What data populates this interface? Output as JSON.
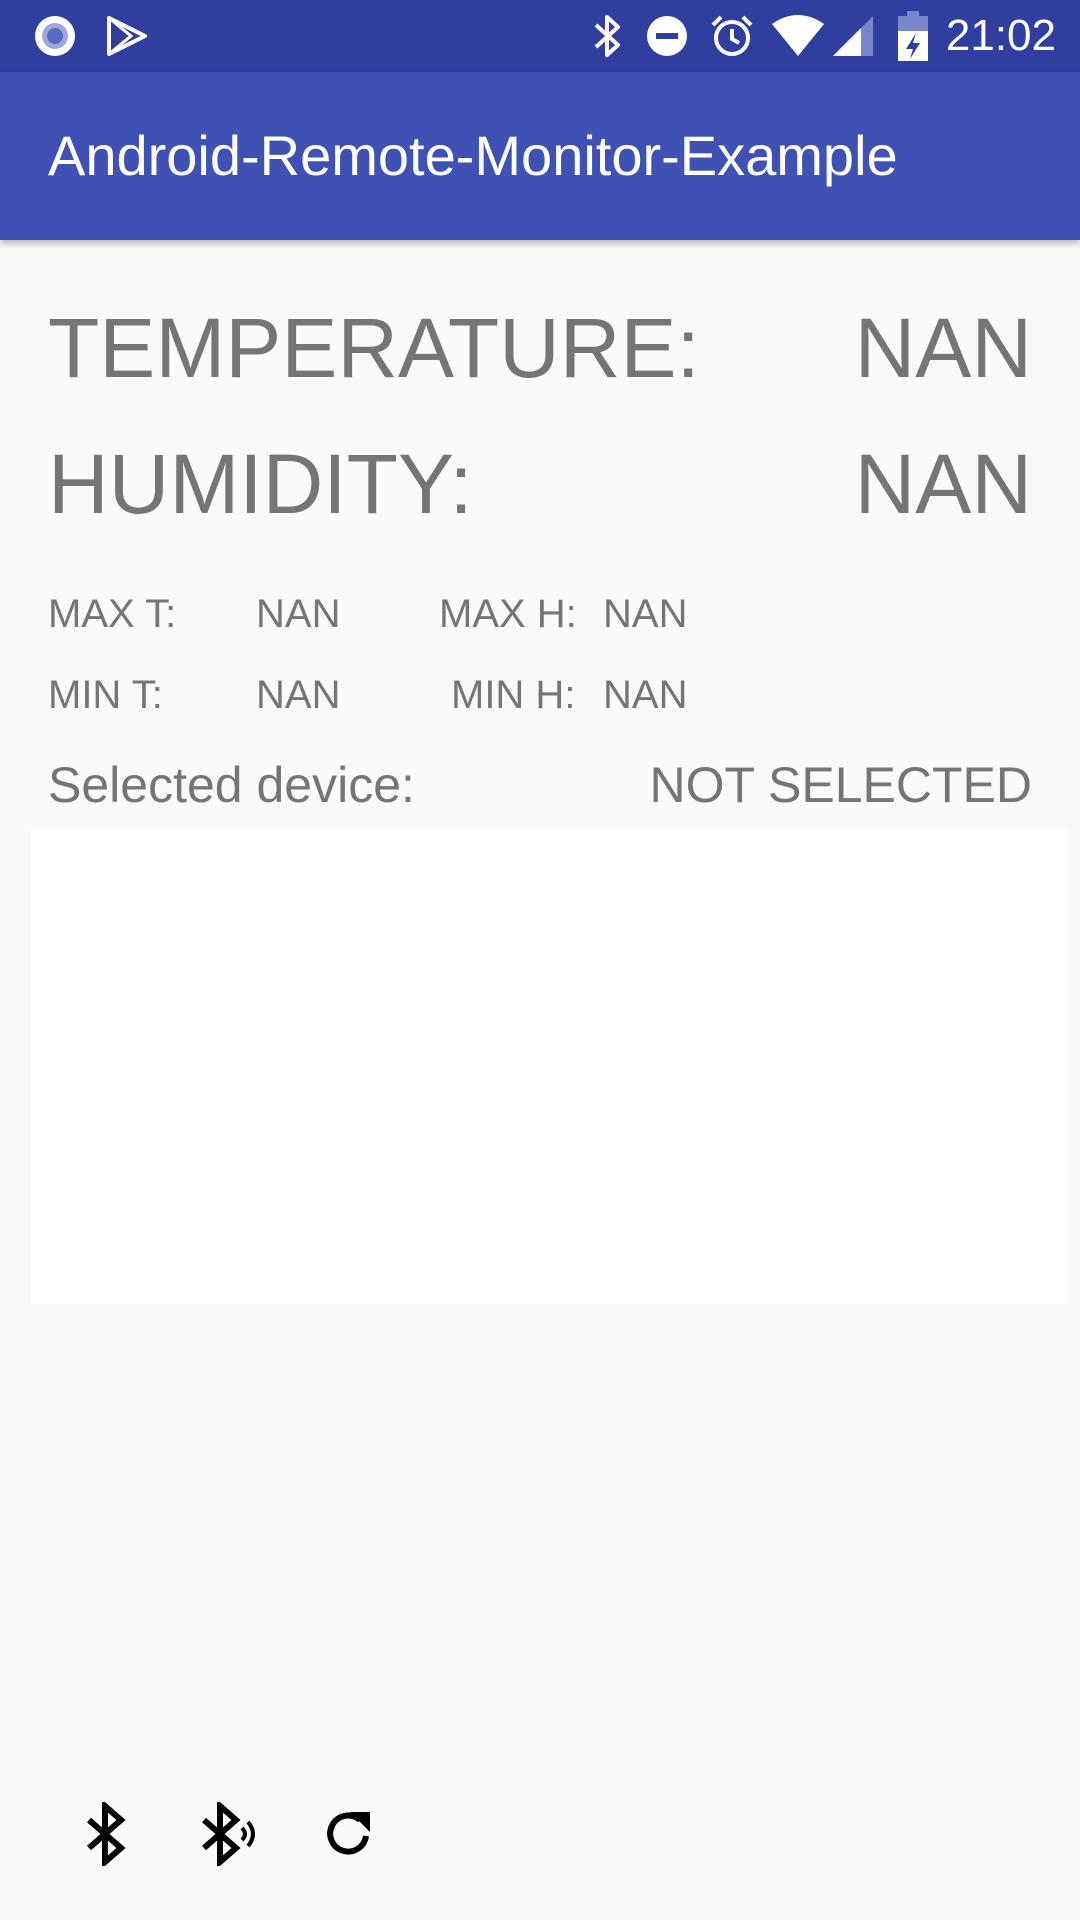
{
  "status_bar": {
    "time": "21:02",
    "icons": [
      "record-icon",
      "play-store-icon",
      "bluetooth-icon",
      "do-not-disturb-icon",
      "alarm-icon",
      "wifi-icon",
      "signal-icon",
      "battery-charging-icon"
    ],
    "background": "#303F9F"
  },
  "app_bar": {
    "title": "Android-Remote-Monitor-Example",
    "background": "#3F51B5"
  },
  "readings": {
    "temperature_label": "TEMPERATURE:",
    "temperature_value": "NAN",
    "humidity_label": "HUMIDITY:",
    "humidity_value": "NAN"
  },
  "stats": {
    "max_t_label": "MAX T:",
    "max_t_value": "NAN",
    "max_h_label": "MAX H:",
    "max_h_value": "NAN",
    "min_t_label": "MIN T:",
    "min_t_value": "NAN",
    "min_h_label": "MIN H:",
    "min_h_value": "NAN"
  },
  "device": {
    "selected_label": "Selected device:",
    "selected_value": "NOT SELECTED"
  },
  "bottom_actions": [
    "bluetooth-icon",
    "bluetooth-searching-icon",
    "refresh-icon"
  ],
  "colors": {
    "text_gray": "#757575",
    "page_background": "#FAFAFA"
  }
}
